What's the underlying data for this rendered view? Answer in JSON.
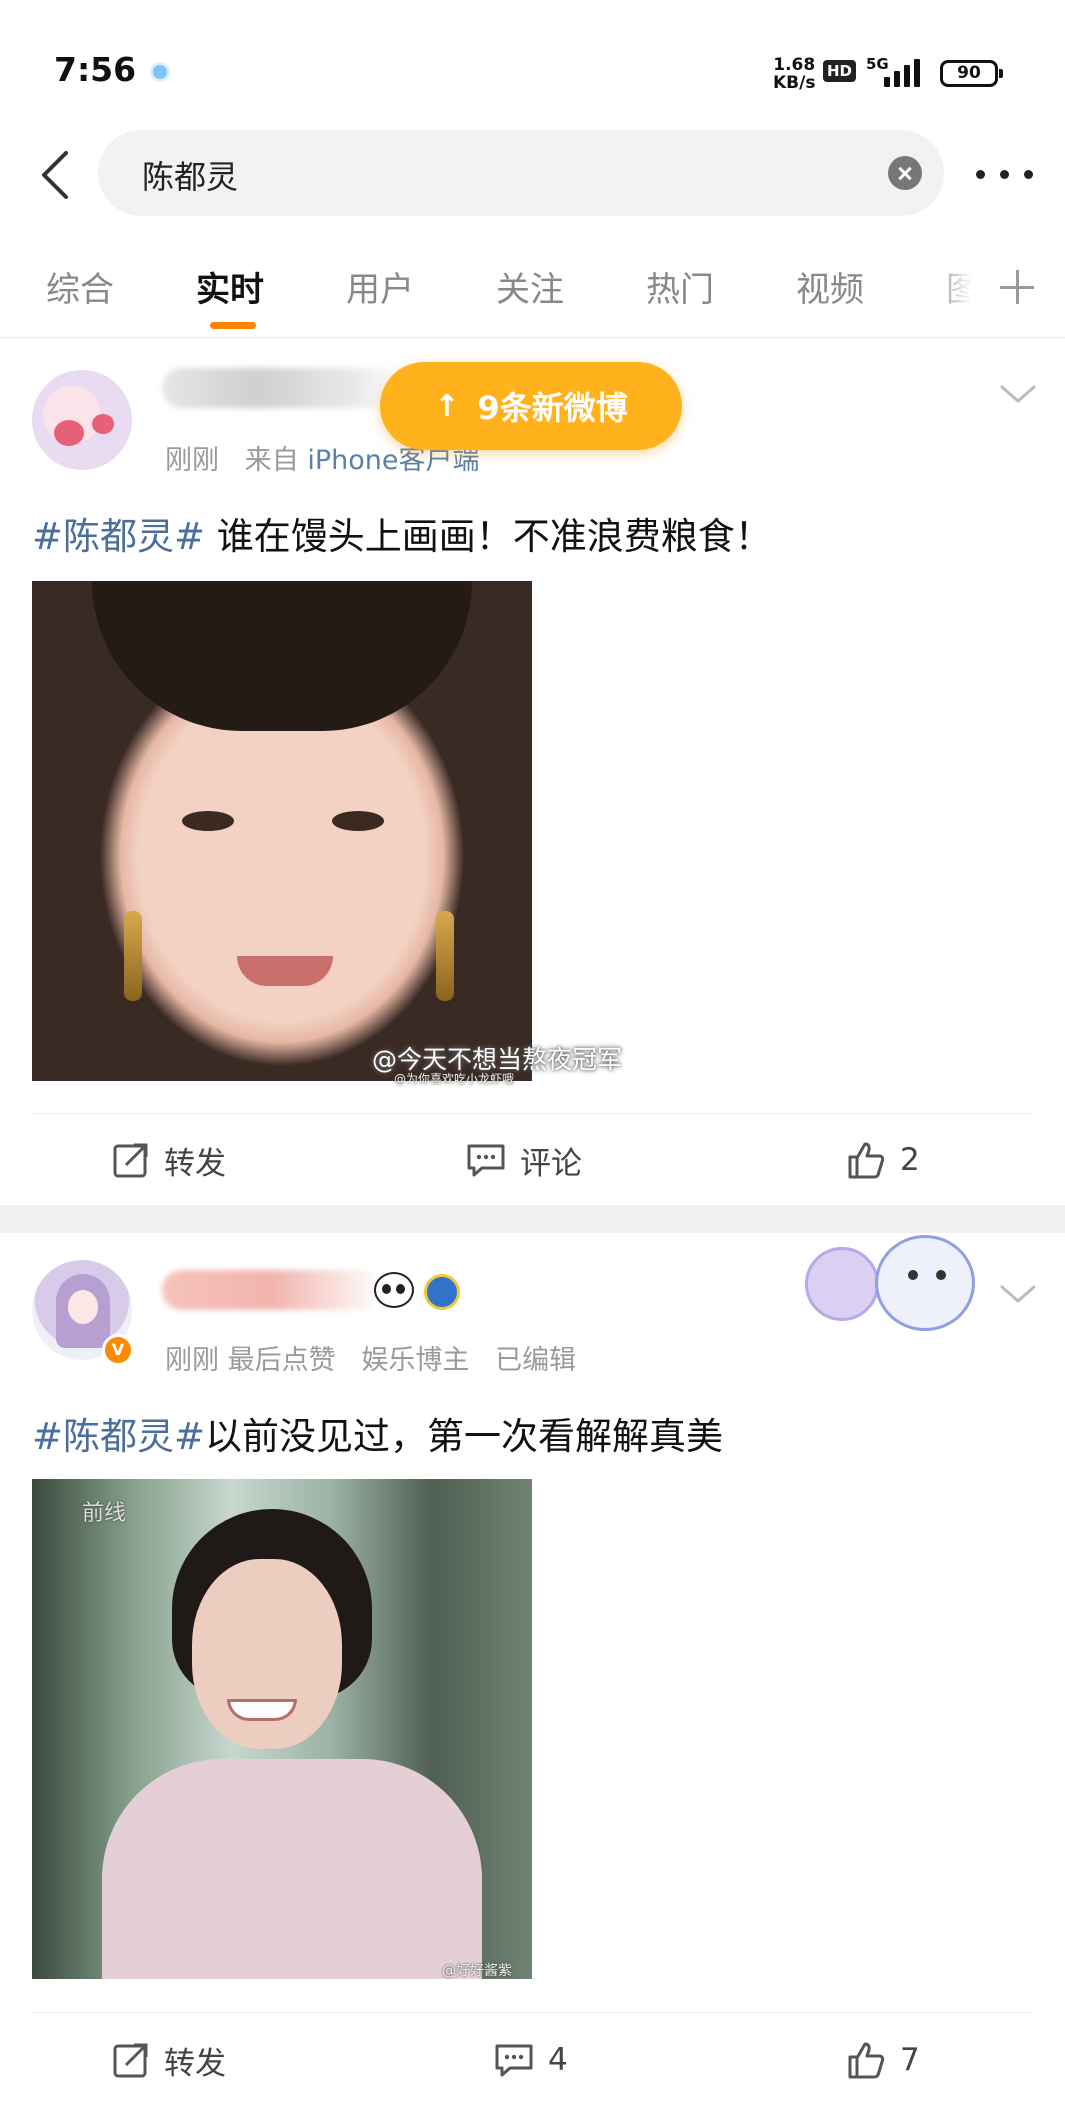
{
  "status_bar": {
    "time": "7:56",
    "net_speed_value": "1.68",
    "net_speed_unit": "KB/s",
    "hd": "HD",
    "network": "5G",
    "battery": "90"
  },
  "search": {
    "query": "陈都灵"
  },
  "tabs": [
    {
      "label": "综合"
    },
    {
      "label": "实时"
    },
    {
      "label": "用户"
    },
    {
      "label": "关注"
    },
    {
      "label": "热门"
    },
    {
      "label": "视频"
    },
    {
      "label": "图"
    }
  ],
  "active_tab": "实时",
  "toast": {
    "label": "9条新微博"
  },
  "posts": [
    {
      "meta": {
        "time": "刚刚",
        "source_prefix": "来自",
        "source": "iPhone客户端"
      },
      "hashtag": "#陈都灵#",
      "text": " 谁在馒头上画画！不准浪费粮食！",
      "watermark": "@今天不想当熬夜冠军",
      "watermark_small": "@为你喜欢吃小龙虾哦",
      "actions": {
        "repost": "转发",
        "comment": "评论",
        "likes": "2"
      }
    },
    {
      "meta": {
        "time": "刚刚",
        "liked": "最后点赞",
        "role": "娱乐博主",
        "edited": "已编辑"
      },
      "hashtag": "#陈都灵#",
      "text": "以前没见过，第一次看解解真美",
      "watermark_small": "@好好酱紫",
      "photo_overlay": "前线",
      "actions": {
        "repost": "转发",
        "comments": "4",
        "likes": "7"
      }
    }
  ],
  "colors": {
    "accent": "#ff8200",
    "toast": "#ffb21b",
    "hashtag": "#4a6f9c"
  }
}
